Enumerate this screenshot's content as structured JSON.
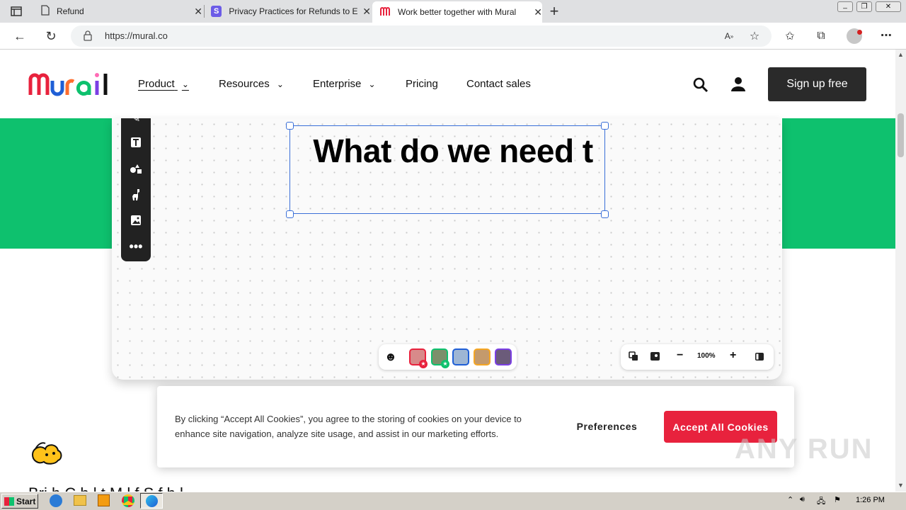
{
  "browser": {
    "tabs": [
      {
        "title": "Refund",
        "icon": "page-icon"
      },
      {
        "title": "Privacy Practices for Refunds to E",
        "icon": "s-logo-icon"
      },
      {
        "title": "Work better together with Mural",
        "icon": "mural-m-icon"
      }
    ],
    "url": "https://mural.co"
  },
  "site": {
    "logo_text": "Mural",
    "nav": {
      "product": "Product",
      "resources": "Resources",
      "enterprise": "Enterprise",
      "pricing": "Pricing",
      "contact": "Contact sales"
    },
    "signup": "Sign up free"
  },
  "canvas": {
    "text": "What do we need t",
    "zoom": "100%"
  },
  "cookie": {
    "text": "By clicking “Accept All Cookies”, you agree to the storing of cookies on your device to enhance site navigation, analyze site usage, and assist in our marketing efforts.",
    "preferences": "Preferences",
    "accept": "Accept All Cookies"
  },
  "page_bottom": "Bri                               h          C      h l  t            M l         f              S           f         h       l",
  "taskbar": {
    "start": "Start",
    "time": "1:26 PM"
  },
  "watermark": "ANY RUN",
  "colors": {
    "green": "#0ec16e",
    "accept": "#e8223d",
    "selection": "#3a6fd8"
  }
}
